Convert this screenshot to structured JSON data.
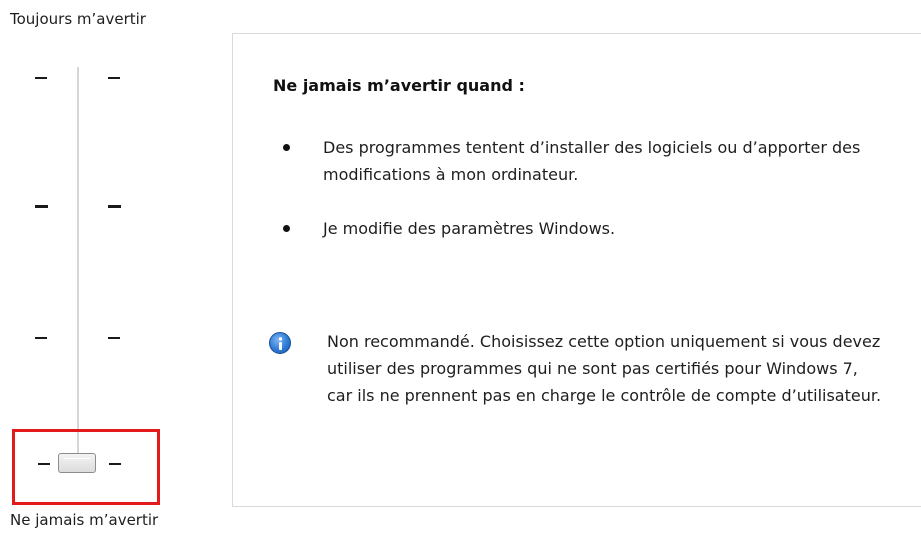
{
  "slider": {
    "top_label": "Toujours m’avertir",
    "bottom_label": "Ne jamais m’avertir",
    "levels": 4,
    "selected_level": 1
  },
  "panel": {
    "heading": "Ne jamais m’avertir quand :",
    "bullets": [
      "Des programmes tentent d’installer des logiciels ou d’apporter des modifications à mon ordinateur.",
      "Je modifie des paramètres Windows."
    ],
    "info_icon": "info-icon",
    "info_text": "Non recommandé. Choisissez cette option uniquement si vous devez utiliser des programmes qui ne sont pas certifiés pour Windows 7, car ils ne prennent pas en charge le contrôle de compte d’utilisateur."
  },
  "colors": {
    "highlight": "#e31a1c",
    "info_blue": "#2e7bd6"
  }
}
